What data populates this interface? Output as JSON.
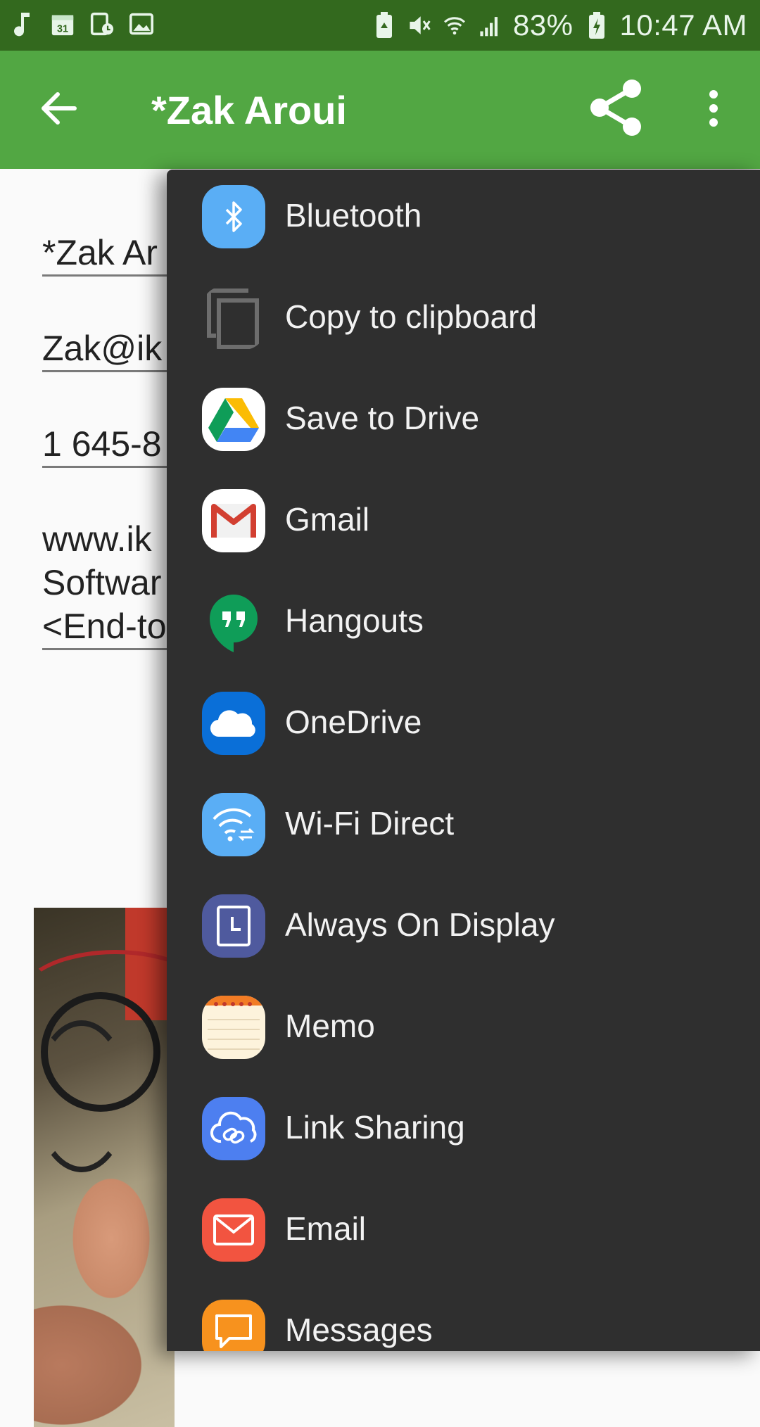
{
  "status_bar": {
    "battery": "83%",
    "time": "10:47 AM",
    "left_icons": [
      "music-note-icon",
      "calendar-icon",
      "screen-record-icon",
      "image-icon"
    ],
    "right_icons": [
      "battery-saver-icon",
      "mute-icon",
      "wifi-icon",
      "signal-icon",
      "battery-charging-icon"
    ],
    "calendar_day": "31"
  },
  "app_bar": {
    "title": "*Zak Aroui",
    "color": "#52a743"
  },
  "form": {
    "name": "*Zak Ar",
    "email": "Zak@ik",
    "phone": "1 645-8",
    "notes": "www.ik\nSoftwar\n<End-to"
  },
  "share_sheet": {
    "items": [
      {
        "label": "Bluetooth",
        "icon": "bluetooth-icon"
      },
      {
        "label": "Copy to clipboard",
        "icon": "copy-icon"
      },
      {
        "label": "Save to Drive",
        "icon": "google-drive-icon"
      },
      {
        "label": "Gmail",
        "icon": "gmail-icon"
      },
      {
        "label": "Hangouts",
        "icon": "hangouts-icon"
      },
      {
        "label": "OneDrive",
        "icon": "onedrive-icon"
      },
      {
        "label": "Wi-Fi Direct",
        "icon": "wifi-direct-icon"
      },
      {
        "label": "Always On Display",
        "icon": "always-on-display-icon"
      },
      {
        "label": "Memo",
        "icon": "memo-icon"
      },
      {
        "label": "Link Sharing",
        "icon": "link-sharing-icon"
      },
      {
        "label": "Email",
        "icon": "email-icon"
      },
      {
        "label": "Messages",
        "icon": "messages-icon"
      }
    ]
  }
}
